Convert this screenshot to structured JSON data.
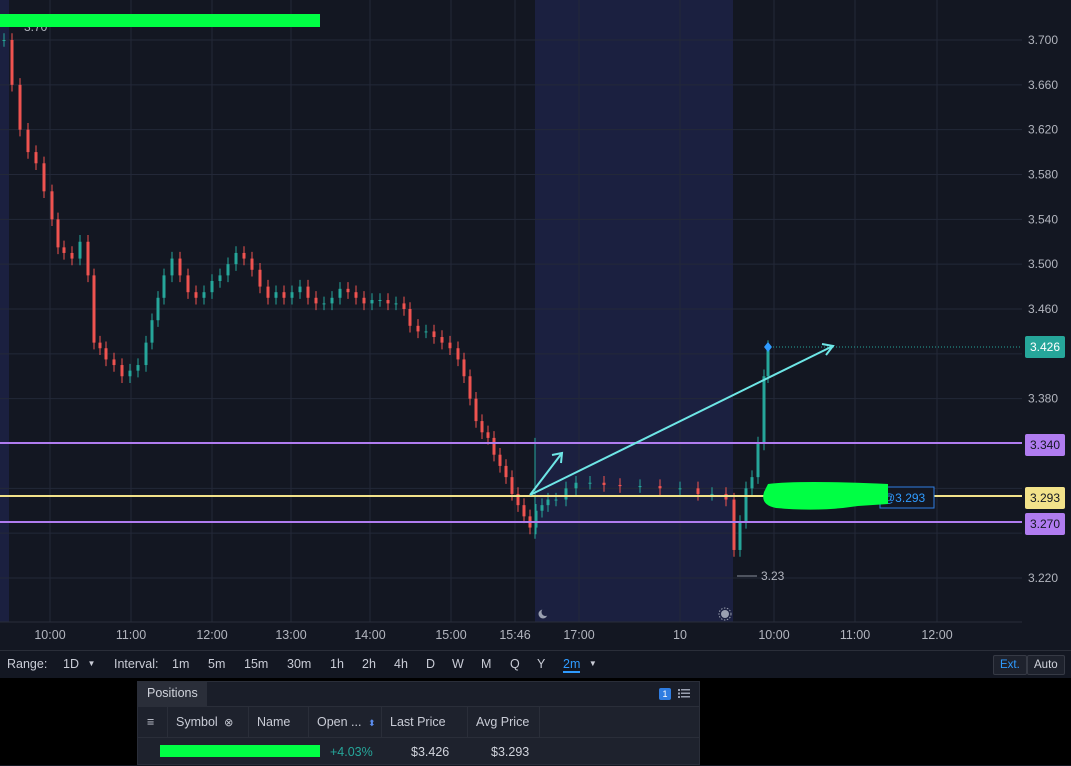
{
  "chart": {
    "colors": {
      "background": "#131722",
      "session_shade": "#1b2040",
      "grid": "#232838",
      "up": "#26a69a",
      "down": "#ef5350",
      "purple_line": "#b07cf0",
      "yellow_line": "#f2e28a",
      "arrow": "#6ee6e6",
      "current_price": "#26a69a",
      "redaction": "#00ff44"
    },
    "price_axis": {
      "labels": [
        "3.700",
        "3.660",
        "3.620",
        "3.580",
        "3.540",
        "3.500",
        "3.460",
        "3.380",
        "3.220"
      ],
      "values": [
        3.7,
        3.66,
        3.62,
        3.58,
        3.54,
        3.5,
        3.46,
        3.38,
        3.22
      ]
    },
    "time_axis": [
      "10:00",
      "11:00",
      "12:00",
      "13:00",
      "14:00",
      "15:00",
      "15:46",
      "17:00",
      "10",
      "10:00",
      "11:00",
      "12:00"
    ],
    "top_label": "3.70",
    "low_marker": "3.23",
    "badges": {
      "current": "3.426",
      "level_high": "3.340",
      "avg": "3.293",
      "level_low": "3.270"
    },
    "order_label": "@3.293",
    "session_icons": {
      "moon": "moon-icon",
      "sun": "sun-icon"
    }
  },
  "toolbar": {
    "range_label": "Range:",
    "range_value": "1D",
    "interval_label": "Interval:",
    "intervals": [
      "1m",
      "5m",
      "15m",
      "30m",
      "1h",
      "2h",
      "4h",
      "D",
      "W",
      "M",
      "Q",
      "Y"
    ],
    "active_interval": "2m",
    "ext_label": "Ext.",
    "auto_label": "Auto"
  },
  "positions": {
    "tab_label": "Positions",
    "count": "1",
    "columns": {
      "symbol": "Symbol",
      "name": "Name",
      "open": "Open ...",
      "last_price": "Last Price",
      "avg_price": "Avg Price"
    },
    "row": {
      "open_pct": "+4.03%",
      "last_price": "$3.426",
      "avg_price": "$3.293"
    }
  }
}
